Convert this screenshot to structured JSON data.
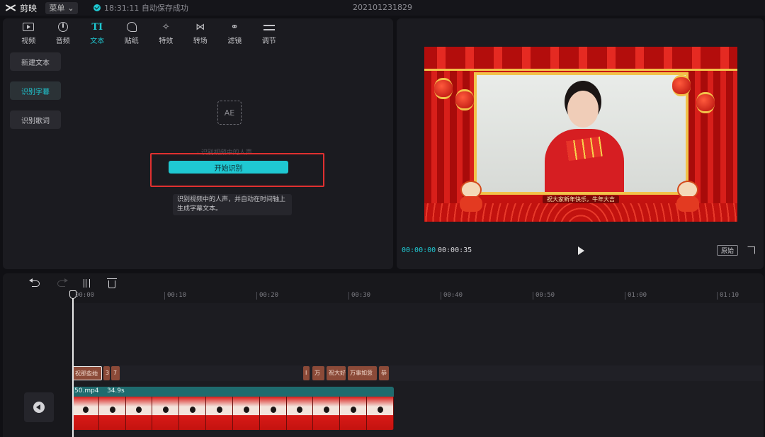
{
  "app": {
    "name": "剪映",
    "menu_label": "菜单",
    "save_status": "18:31:11 自动保存成功",
    "project_title": "202101231829"
  },
  "tabs": [
    {
      "label": "视频",
      "icon": "video-icon"
    },
    {
      "label": "音频",
      "icon": "audio-icon"
    },
    {
      "label": "文本",
      "icon": "text-icon",
      "active": true
    },
    {
      "label": "贴纸",
      "icon": "sticker-icon"
    },
    {
      "label": "特效",
      "icon": "effects-icon"
    },
    {
      "label": "转场",
      "icon": "transition-icon"
    },
    {
      "label": "滤镜",
      "icon": "filter-icon"
    },
    {
      "label": "调节",
      "icon": "adjust-icon"
    }
  ],
  "text_menu": {
    "items": [
      "新建文本",
      "识别字幕",
      "识别歌词"
    ],
    "active_index": 1
  },
  "caption": {
    "icon_label": "AE",
    "faded_hint": "· 识别视频中的人声",
    "start_button": "开始识别",
    "description_line1": "识别视频中的人声，并自动在时间轴上",
    "description_line2": "生成字幕文本。"
  },
  "preview": {
    "caption_text": "祝大家新年快乐，牛年大吉",
    "time_current": "00:00:00",
    "time_total": "00:00:35",
    "ratio_label": "原始"
  },
  "timeline": {
    "ruler_ticks": [
      "00:00",
      "00:10",
      "00:20",
      "00:30",
      "00:40",
      "00:50",
      "01:00",
      "01:10"
    ],
    "text_clips": [
      {
        "label": "祝那些她"
      },
      {
        "label": "3"
      },
      {
        "label": "7"
      },
      {
        "label": "I"
      },
      {
        "label": "万"
      },
      {
        "label": "祝大好"
      },
      {
        "label": "万事如意"
      },
      {
        "label": "恭"
      }
    ],
    "video_clip": {
      "name": "50.mp4",
      "duration": "34.9s"
    }
  },
  "colors": {
    "accent": "#1fc8d2",
    "highlight": "#e03030",
    "text_clip": "#8b4a38",
    "video_clip": "#1f6b6e"
  }
}
